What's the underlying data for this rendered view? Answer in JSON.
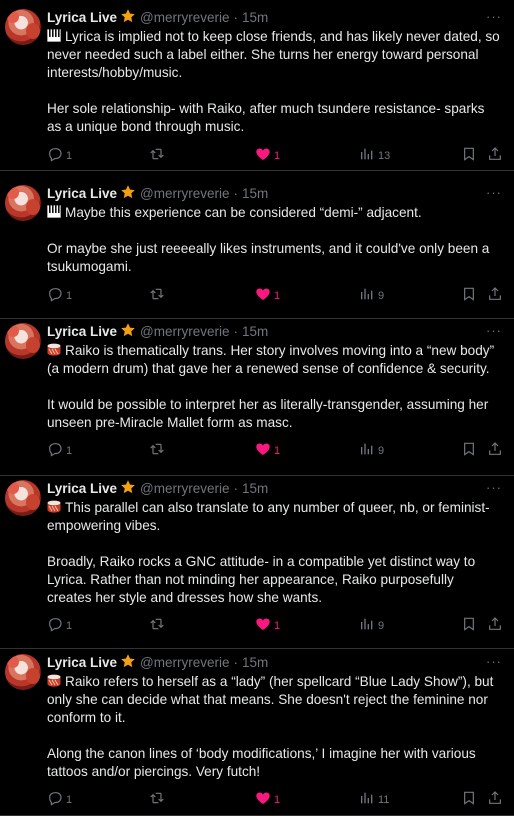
{
  "author": {
    "name": "Lyrica Live",
    "handle": "@merryreverie",
    "separator": "·",
    "time": "15m",
    "badge_icon": "star-icon",
    "more_icon": "more-icon",
    "more_label": "···"
  },
  "colors": {
    "background": "#000000",
    "text": "#e7e9ea",
    "muted": "#71767b",
    "like": "#f91880",
    "badge": "#f4a012"
  },
  "tweets": [
    {
      "emoji": "piano-keys-icon",
      "paragraphs": [
        "Lyrica is implied not to keep close friends, and has likely never dated, so never needed such a label either.  She turns her energy toward personal interests/hobby/music.",
        "Her sole relationship- with Raiko, after much tsundere resistance- sparks as a unique bond through music."
      ],
      "replies": "1",
      "likes": "1",
      "views": "13"
    },
    {
      "emoji": "piano-keys-icon",
      "paragraphs": [
        "Maybe this experience can be considered “demi-” adjacent.",
        "Or maybe she just reeeeally likes instruments, and it could've only been a tsukumogami."
      ],
      "replies": "1",
      "likes": "1",
      "views": "9"
    },
    {
      "emoji": "drum-icon",
      "paragraphs": [
        "Raiko is thematically trans.  Her story involves moving into a “new body” (a modern drum) that gave her a renewed sense of confidence & security.",
        "It would be possible to interpret her as literally-transgender, assuming her unseen pre-Miracle Mallet form as masc."
      ],
      "replies": "1",
      "likes": "1",
      "views": "9"
    },
    {
      "emoji": "drum-icon",
      "paragraphs": [
        "This parallel can also translate to any number of queer, nb, or feminist-empowering vibes.",
        "Broadly, Raiko rocks a GNC attitude- in a compatible yet distinct way to Lyrica.  Rather than not minding her appearance, Raiko purposefully creates her style and dresses how she wants."
      ],
      "replies": "1",
      "likes": "1",
      "views": "9"
    },
    {
      "emoji": "drum-icon",
      "paragraphs": [
        "Raiko refers to herself as a “lady” (her spellcard “Blue Lady Show”), but only she can decide what that means.  She doesn't reject the feminine nor conform to it.",
        "Along the canon lines of ‘body modifications,’ I imagine her with various tattoos and/or piercings.  Very futch!"
      ],
      "replies": "1",
      "likes": "1",
      "views": "11"
    }
  ]
}
